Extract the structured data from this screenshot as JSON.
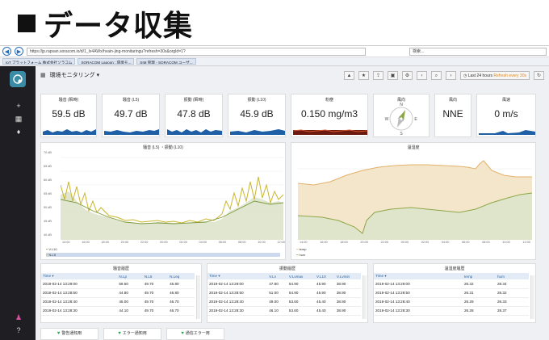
{
  "slide": {
    "title": "データ収集"
  },
  "browser": {
    "url": "https://jp.rapsan.soracom.io/d/1_Ix4AWx/hvain-jing-monitaringu?refresh=30s&orgId=1?",
    "search_placeholder": "検索...",
    "tabs": [
      "IoT プラットフォーム 株式会社ソラコム",
      "SORACOM Lagoon : 環境モ...",
      "SIM 管理 - SORACOM ユーザ..."
    ]
  },
  "dashboard": {
    "title": "環境モニタリング ▾",
    "time_range": "Last 24 hours",
    "refresh": "Refresh every 30s"
  },
  "stats": [
    {
      "title": "騒音 (瞬時)",
      "value": "59.5 dB"
    },
    {
      "title": "騒音 (L5)",
      "value": "49.7 dB"
    },
    {
      "title": "振動 (瞬時)",
      "value": "47.8 dB"
    },
    {
      "title": "振動 (L10)",
      "value": "45.9 dB"
    },
    {
      "title": "粉塵",
      "value": "0.150 mg/m3"
    },
    {
      "title": "風向",
      "value": ""
    },
    {
      "title": "風向",
      "value": "NNE"
    },
    {
      "title": "風速",
      "value": "0 m/s"
    }
  ],
  "compass": {
    "n": "N",
    "e": "E",
    "s": "S",
    "w": "W"
  },
  "graph_left": {
    "title": "騒音 (L5) ・振動 (L10)",
    "yticks": [
      "70 dB",
      "65 dB",
      "60 dB",
      "55 dB",
      "50 dB",
      "45 dB",
      "40 dB"
    ],
    "xticks": [
      "14:00",
      "16:00",
      "18:00",
      "20:00",
      "22:00",
      "00:00",
      "02:00",
      "04:00",
      "06:00",
      "08:00",
      "10:00",
      "12:00"
    ],
    "legend": [
      "V.L10",
      "N.L5"
    ]
  },
  "graph_right": {
    "title": "温湿度",
    "xticks": [
      "14:00",
      "16:00",
      "18:00",
      "20:00",
      "22:00",
      "00:00",
      "02:00",
      "04:00",
      "06:00",
      "08:00",
      "10:00",
      "12:00"
    ],
    "legend": [
      "temp",
      "hum"
    ]
  },
  "tables": [
    {
      "title": "騒音履歴",
      "headers": [
        "Time ▾",
        "N.Lp",
        "N.L5",
        "N.Leq"
      ],
      "rows": [
        [
          "2019-02-14 13:29:00",
          "59.50",
          "49.70",
          "46.80"
        ],
        [
          "2019-02-14 13:28:50",
          "44.80",
          "49.70",
          "46.80"
        ],
        [
          "2019-02-14 13:28:40",
          "45.00",
          "49.70",
          "46.70"
        ],
        [
          "2019-02-14 13:28:30",
          "44.10",
          "49.70",
          "46.70"
        ]
      ]
    },
    {
      "title": "振動履歴",
      "headers": [
        "Time ▾",
        "V.Lv",
        "V.Lvmax",
        "V.L10",
        "V.Lvmin"
      ],
      "rows": [
        [
          "2019-02-14 13:29:00",
          "47.80",
          "54.90",
          "45.90",
          "38.90"
        ],
        [
          "2019-02-14 13:28:50",
          "51.00",
          "54.90",
          "45.90",
          "38.90"
        ],
        [
          "2019-02-14 13:28:40",
          "49.00",
          "53.60",
          "45.40",
          "38.90"
        ],
        [
          "2019-02-14 13:28:30",
          "46.10",
          "53.60",
          "45.40",
          "38.90"
        ]
      ]
    },
    {
      "title": "温湿度履歴",
      "headers": [
        "Time ▾",
        "temp",
        "hum"
      ],
      "rows": [
        [
          "2019-02-14 13:29:00",
          "26.32",
          "28.34"
        ],
        [
          "2019-02-14 13:28:50",
          "26.31",
          "28.32"
        ],
        [
          "2019-02-14 13:28:40",
          "26.29",
          "28.33"
        ],
        [
          "2019-02-14 13:28:30",
          "26.28",
          "28.37"
        ]
      ]
    }
  ],
  "alerts": [
    "警告通知用",
    "エラー通知用",
    "通信エラー用"
  ],
  "colors": {
    "sidebar": "#1f1f23",
    "spark": "#1f5fa6",
    "noise": "#c9b52a",
    "vib": "#8fa647",
    "temp": "#e3b16b",
    "hum": "#a5b87d"
  }
}
